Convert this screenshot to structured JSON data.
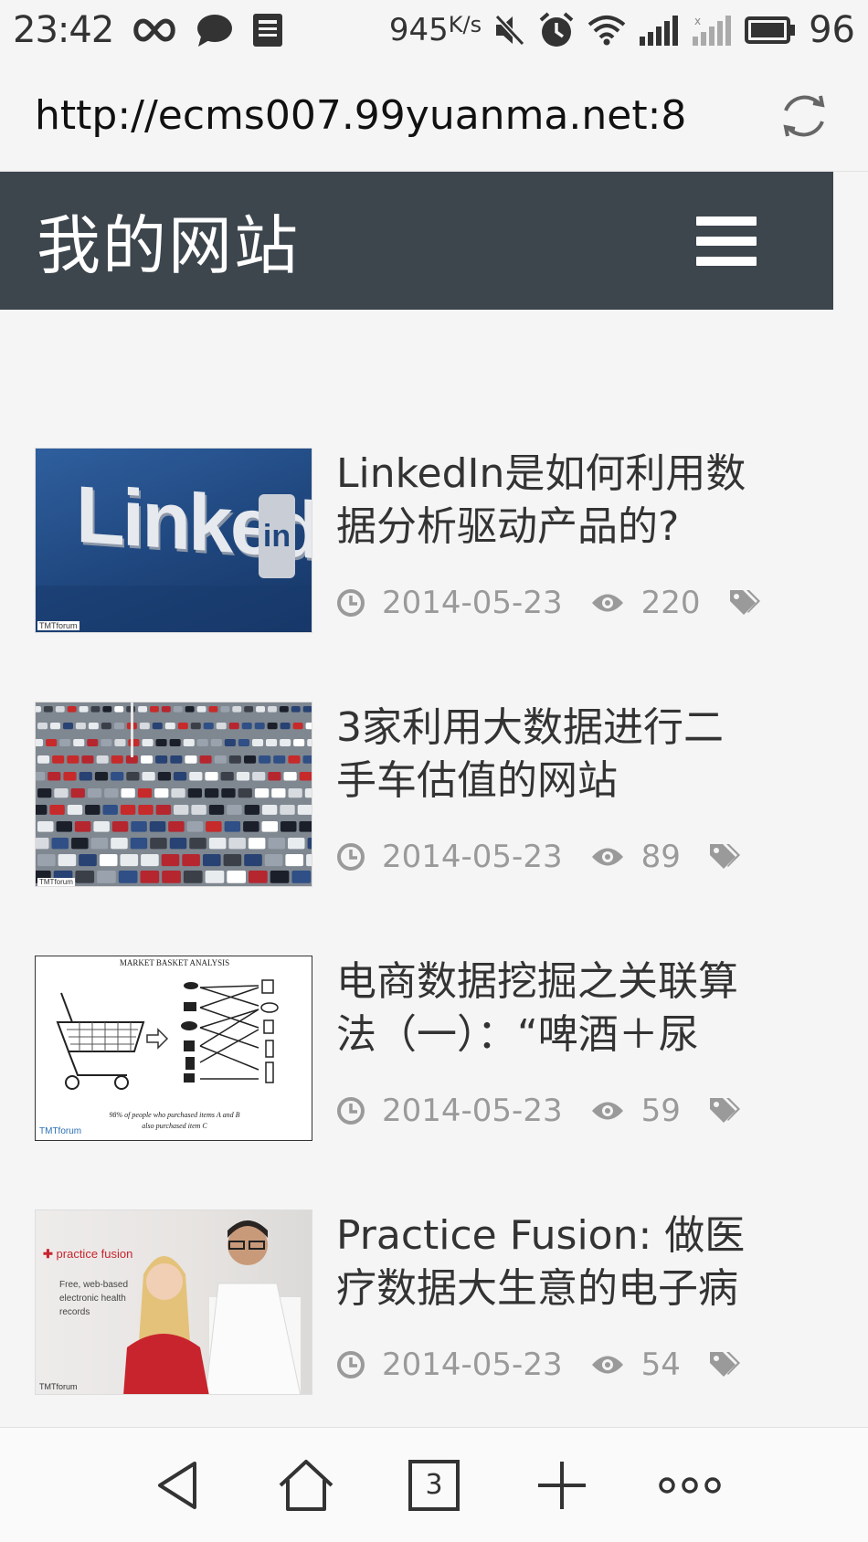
{
  "status_bar": {
    "time": "23:42",
    "speed": "945",
    "speed_unit": "K/s",
    "battery": "96",
    "icons": [
      "infinity-icon",
      "chat-icon",
      "news-icon",
      "mute-icon",
      "alarm-icon",
      "wifi-icon",
      "signal-icon",
      "signal-off-icon",
      "battery-icon"
    ]
  },
  "address_bar": {
    "url": "http://ecms007.99yuanma.net:8 ..",
    "reload_icon": "reload-icon"
  },
  "header": {
    "title": "我的网站",
    "menu_icon": "hamburger-menu-icon",
    "background": "#3d464d"
  },
  "articles": [
    {
      "title": "LinkedIn是如何利用数据分析驱动产品的?",
      "date": "2014-05-23",
      "views": "220",
      "thumb_text": "Linked",
      "thumb_badge": "in",
      "watermark": "TMTforum"
    },
    {
      "title": "3家利用大数据进行二手车估值的网站",
      "date": "2014-05-23",
      "views": "89",
      "watermark": "TMTforum"
    },
    {
      "title": "电商数据挖掘之关联算法（一）：“啤酒＋尿",
      "date": "2014-05-23",
      "views": "59",
      "thumb_heading": "MARKET BASKET ANALYSIS",
      "thumb_caption_1": "98% of people who purchased items A and B",
      "thumb_caption_2": "also purchased item C",
      "watermark": "TMTforum"
    },
    {
      "title": "Practice Fusion: 做医疗数据大生意的电子病",
      "date": "2014-05-23",
      "views": "54",
      "thumb_brand": "practice fusion",
      "thumb_tagline_1": "Free, web-based",
      "thumb_tagline_2": "electronic health",
      "thumb_tagline_3": "records",
      "watermark": "TMTforum"
    }
  ],
  "bottom_nav": {
    "tab_count": "3",
    "icons": [
      "back-icon",
      "home-icon",
      "tabs-icon",
      "add-icon",
      "more-icon"
    ]
  }
}
